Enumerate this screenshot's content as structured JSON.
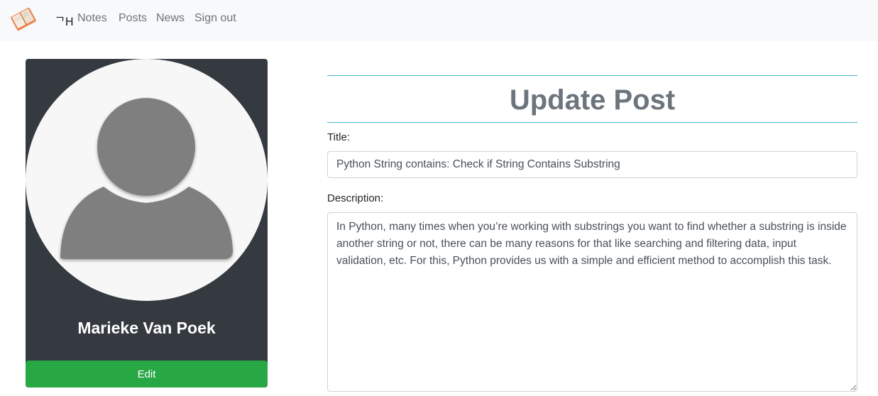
{
  "navbar": {
    "brand": "ᄀH",
    "links": [
      "Notes",
      "Posts",
      "News",
      "Sign out"
    ]
  },
  "profile": {
    "name": "Marieke Van Poek",
    "edit_label": "Edit"
  },
  "form": {
    "heading": "Update Post",
    "title_label": "Title:",
    "title_value": "Python String contains: Check if String Contains Substring",
    "description_label": "Description:",
    "description_value": "In Python, many times when you’re working with substrings you want to find whether a substring is inside another string or not, there can be many reasons for that like searching and filtering data, input validation, etc. For this, Python provides us with a simple and efficient method to accomplish this task."
  },
  "colors": {
    "navbar_bg": "#f8f9fa",
    "card_bg": "#343a40",
    "edit_button": "#28a745",
    "rule": "#17a2b8",
    "heading": "#6c757d"
  }
}
